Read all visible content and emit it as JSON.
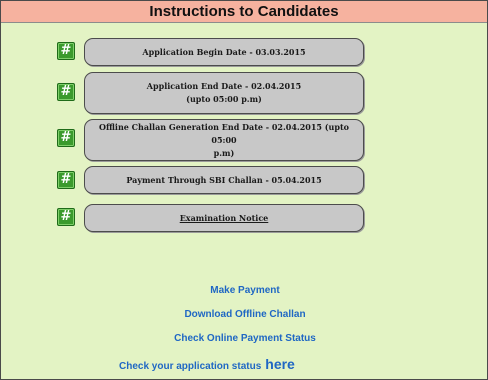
{
  "header": {
    "title": "Instructions to Candidates"
  },
  "items": [
    {
      "badge": "#",
      "line1": "Application Begin Date - 03.03.2015",
      "line2": ""
    },
    {
      "badge": "#",
      "line1": "Application End Date - 02.04.2015",
      "line2": "(upto 05:00 p.m)"
    },
    {
      "badge": "#",
      "line1": "Offline Challan Generation End Date - 02.04.2015 (upto 05:00",
      "line2": "p.m)"
    },
    {
      "badge": "#",
      "line1": "Payment Through SBI Challan - 05.04.2015",
      "line2": ""
    },
    {
      "badge": "#",
      "line1": "Examination Notice",
      "line2": ""
    }
  ],
  "links": {
    "make_payment": "Make Payment",
    "download_challan": "Download Offline Challan",
    "check_payment": "Check Online Payment Status",
    "status_text": "Check your application status",
    "status_here": "here"
  },
  "colors": {
    "header_bg": "#f6b29f",
    "page_bg": "#e3f3c4",
    "pill_bg": "#c8c8c8",
    "badge_bg": "#3b9a2d",
    "link": "#1f67c4"
  }
}
